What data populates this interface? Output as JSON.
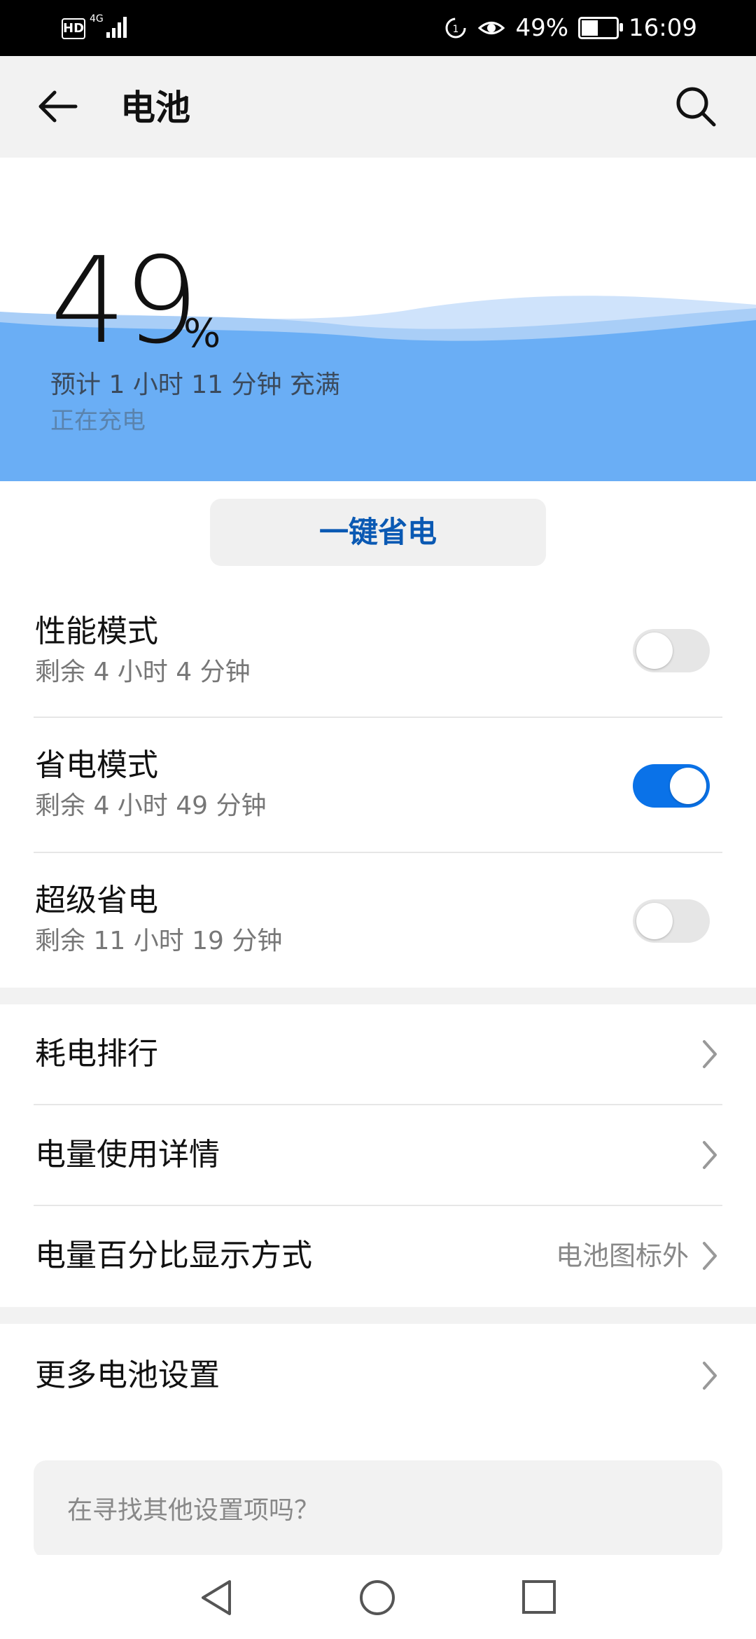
{
  "status_bar": {
    "hd": "HD",
    "net": "4G",
    "battery_percent": "49%",
    "time": "16:09",
    "icons": [
      "signal-icon",
      "data-saver-icon",
      "eye-comfort-icon",
      "battery-charging-icon"
    ]
  },
  "header": {
    "title": "电池",
    "back_icon": "arrow-left-icon",
    "search_icon": "search-icon"
  },
  "battery": {
    "level": 49,
    "level_text": "49",
    "percent_sign": "%",
    "eta": "预计 1 小时 11 分钟 充满",
    "status": "正在充电"
  },
  "one_key_save": {
    "label": "一键省电"
  },
  "modes": [
    {
      "title": "性能模式",
      "subtitle": "剩余 4 小时 4 分钟",
      "enabled": false
    },
    {
      "title": "省电模式",
      "subtitle": "剩余 4 小时 49 分钟",
      "enabled": true
    },
    {
      "title": "超级省电",
      "subtitle": "剩余 11 小时 19 分钟",
      "enabled": false
    }
  ],
  "settings": [
    {
      "label": "耗电排行",
      "value": ""
    },
    {
      "label": "电量使用详情",
      "value": ""
    },
    {
      "label": "电量百分比显示方式",
      "value": "电池图标外"
    }
  ],
  "more": {
    "label": "更多电池设置"
  },
  "search_prompt": {
    "placeholder": "在寻找其他设置项吗？"
  },
  "colors": {
    "accent": "#0a72e8",
    "wave": "#6aaef5",
    "button_text": "#0a59b3"
  }
}
